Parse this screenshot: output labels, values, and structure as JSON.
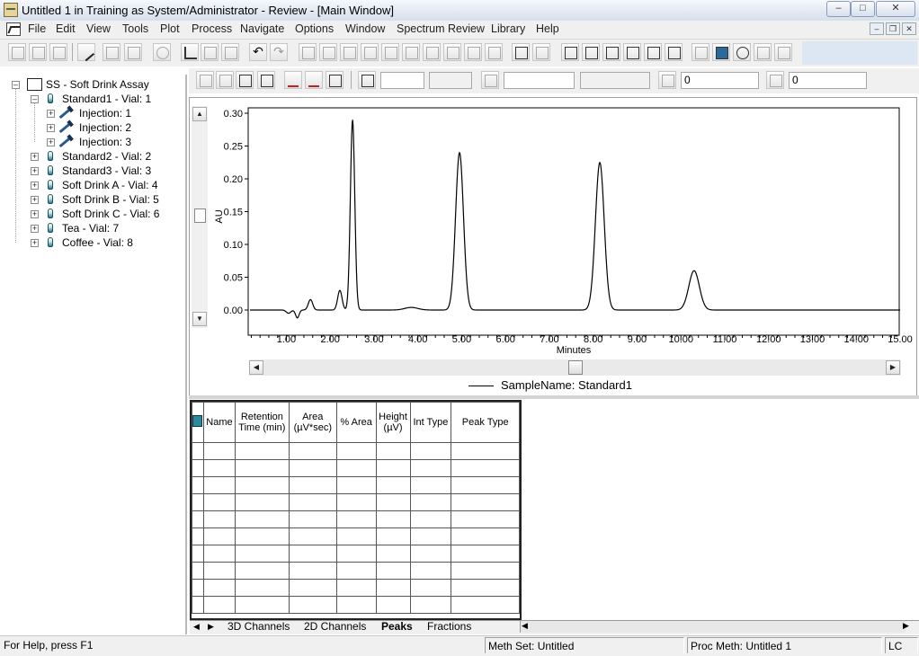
{
  "window": {
    "title": "Untitled 1 in Training as System/Administrator - Review - [Main Window]"
  },
  "menu": {
    "items": [
      "File",
      "Edit",
      "View",
      "Tools",
      "Plot",
      "Process",
      "Navigate",
      "Options",
      "Window",
      "Spectrum Review",
      "Library",
      "Help"
    ]
  },
  "toolbar2": {
    "field1": "0",
    "field2": "0"
  },
  "tree": {
    "root": "SS - Soft Drink Assay",
    "nodes": [
      {
        "label": "Standard1 - Vial: 1",
        "expanded": true,
        "children": [
          "Injection: 1",
          "Injection: 2",
          "Injection: 3"
        ]
      },
      {
        "label": "Standard2 - Vial: 2"
      },
      {
        "label": "Standard3 - Vial: 3"
      },
      {
        "label": "Soft Drink A - Vial: 4"
      },
      {
        "label": "Soft Drink B - Vial: 5"
      },
      {
        "label": "Soft Drink C - Vial: 6"
      },
      {
        "label": "Tea - Vial: 7"
      },
      {
        "label": "Coffee - Vial: 8"
      }
    ]
  },
  "chart_data": {
    "type": "line",
    "xlabel": "Minutes",
    "ylabel": "AU",
    "xlim": [
      0,
      15
    ],
    "ylim": [
      -0.03,
      0.31
    ],
    "x_ticks": [
      "1.00",
      "2.00",
      "3.00",
      "4.00",
      "5.00",
      "6.00",
      "7.00",
      "8.00",
      "9.00",
      "10.00",
      "11.00",
      "12.00",
      "13.00",
      "14.00",
      "15.00"
    ],
    "y_ticks": [
      "0.00",
      "0.05",
      "0.10",
      "0.15",
      "0.20",
      "0.25",
      "0.30"
    ],
    "legend": "SampleName: Standard1",
    "series": [
      {
        "name": "SampleName: Standard1",
        "peaks": [
          {
            "rt": 1.05,
            "height": -0.005,
            "width": 0.05
          },
          {
            "rt": 1.25,
            "height": -0.012,
            "width": 0.04
          },
          {
            "rt": 1.55,
            "height": 0.016,
            "width": 0.05
          },
          {
            "rt": 2.22,
            "height": 0.03,
            "width": 0.05
          },
          {
            "rt": 2.51,
            "height": 0.29,
            "width": 0.05
          },
          {
            "rt": 3.85,
            "height": 0.004,
            "width": 0.15
          },
          {
            "rt": 4.95,
            "height": 0.24,
            "width": 0.09
          },
          {
            "rt": 8.15,
            "height": 0.225,
            "width": 0.1
          },
          {
            "rt": 10.3,
            "height": 0.06,
            "width": 0.12
          }
        ]
      }
    ]
  },
  "peaks_table": {
    "columns": [
      "Name",
      "Retention Time (min)",
      "Area (µV*sec)",
      "% Area",
      "Height (µV)",
      "Int Type",
      "Peak Type"
    ],
    "rows": [
      [
        "",
        "",
        "",
        "",
        "",
        "",
        ""
      ],
      [
        "",
        "",
        "",
        "",
        "",
        "",
        ""
      ],
      [
        "",
        "",
        "",
        "",
        "",
        "",
        ""
      ],
      [
        "",
        "",
        "",
        "",
        "",
        "",
        ""
      ],
      [
        "",
        "",
        "",
        "",
        "",
        "",
        ""
      ],
      [
        "",
        "",
        "",
        "",
        "",
        "",
        ""
      ],
      [
        "",
        "",
        "",
        "",
        "",
        "",
        ""
      ],
      [
        "",
        "",
        "",
        "",
        "",
        "",
        ""
      ],
      [
        "",
        "",
        "",
        "",
        "",
        "",
        ""
      ],
      [
        "",
        "",
        "",
        "",
        "",
        "",
        ""
      ]
    ]
  },
  "tabs": {
    "items": [
      "3D Channels",
      "2D Channels",
      "Peaks",
      "Fractions"
    ],
    "active": "Peaks"
  },
  "status": {
    "help": "For Help, press F1",
    "meth_set": "Meth Set: Untitled",
    "proc_meth": "Proc Meth: Untitled 1",
    "mode": "LC"
  }
}
